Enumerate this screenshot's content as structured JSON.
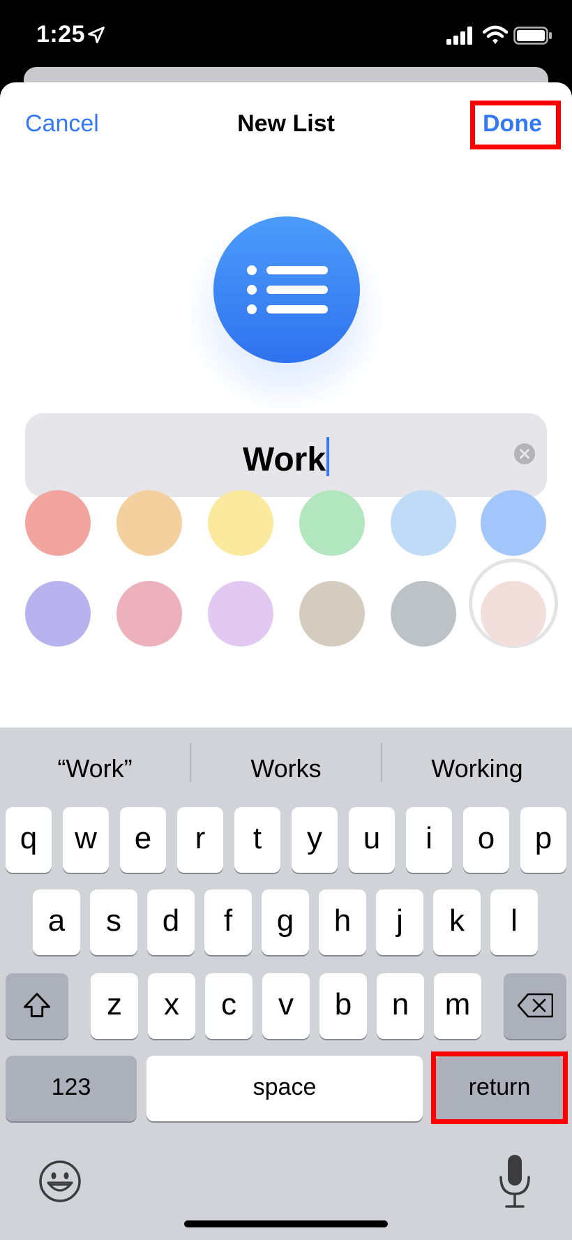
{
  "status_bar": {
    "time": "1:25"
  },
  "nav": {
    "cancel_label": "Cancel",
    "title": "New List",
    "done_label": "Done"
  },
  "list_icon": {
    "icon": "list-bullet-icon",
    "color": "#3478f6"
  },
  "name_field": {
    "value": "Work"
  },
  "colors": [
    "#f2a59f",
    "#f4d09e",
    "#fbe99e",
    "#b2e6be",
    "#c0dbf7",
    "#a2c5fb",
    "#b8b3ef",
    "#ecb1bd",
    "#e1c9f1",
    "#d5ccc0",
    "#bcc2c6",
    "#f2dfdc"
  ],
  "selected_color_index": 5,
  "keyboard": {
    "suggestions": [
      "“Work”",
      "Works",
      "Working"
    ],
    "rows": [
      [
        "q",
        "w",
        "e",
        "r",
        "t",
        "y",
        "u",
        "i",
        "o",
        "p"
      ],
      [
        "a",
        "s",
        "d",
        "f",
        "g",
        "h",
        "j",
        "k",
        "l"
      ],
      [
        "z",
        "x",
        "c",
        "v",
        "b",
        "n",
        "m"
      ]
    ],
    "numbers_label": "123",
    "space_label": "space",
    "return_label": "return"
  }
}
